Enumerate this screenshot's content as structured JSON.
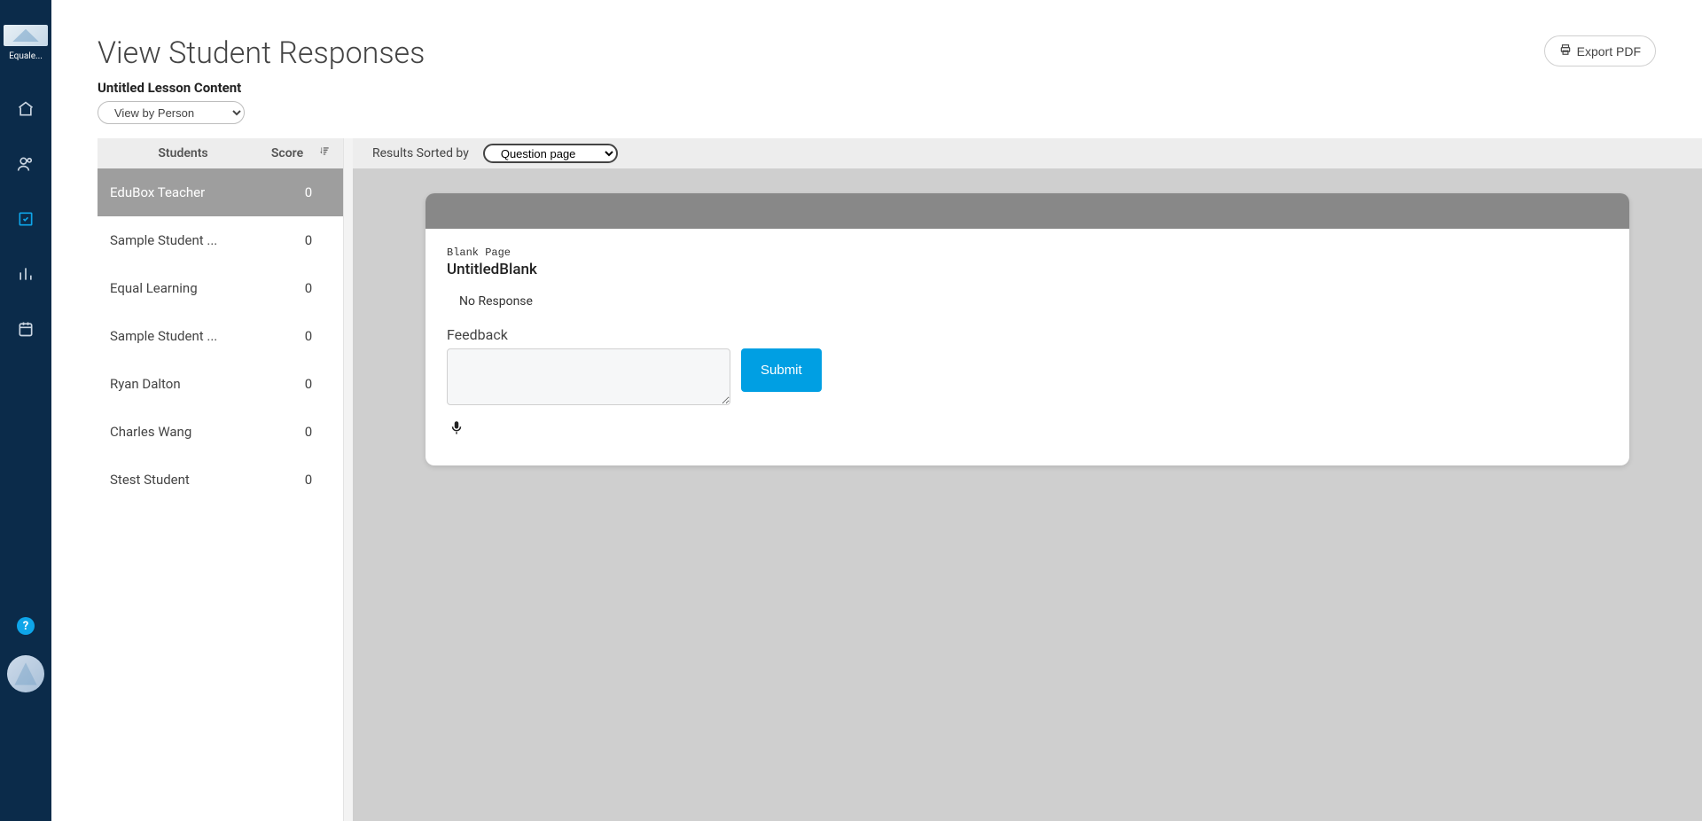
{
  "nav": {
    "brand_label": "Equale...",
    "help_label": "?"
  },
  "page": {
    "title": "View Student Responses",
    "export_label": "Export PDF"
  },
  "lesson": {
    "title": "Untitled Lesson Content",
    "view_selected": "View by Person"
  },
  "students": {
    "col_name": "Students",
    "col_score": "Score",
    "rows": [
      {
        "name": "EduBox Teacher",
        "score": "0",
        "selected": true
      },
      {
        "name": "Sample Student ...",
        "score": "0",
        "selected": false
      },
      {
        "name": "Equal Learning",
        "score": "0",
        "selected": false
      },
      {
        "name": "Sample Student ...",
        "score": "0",
        "selected": false
      },
      {
        "name": "Ryan Dalton",
        "score": "0",
        "selected": false
      },
      {
        "name": "Charles Wang",
        "score": "0",
        "selected": false
      },
      {
        "name": "Stest Student",
        "score": "0",
        "selected": false
      }
    ]
  },
  "results": {
    "sorted_label": "Results Sorted by",
    "sort_selected": "Question page"
  },
  "card": {
    "page_type": "Blank Page",
    "page_name": "UntitledBlank",
    "no_response": "No Response",
    "feedback_label": "Feedback",
    "submit_label": "Submit"
  }
}
